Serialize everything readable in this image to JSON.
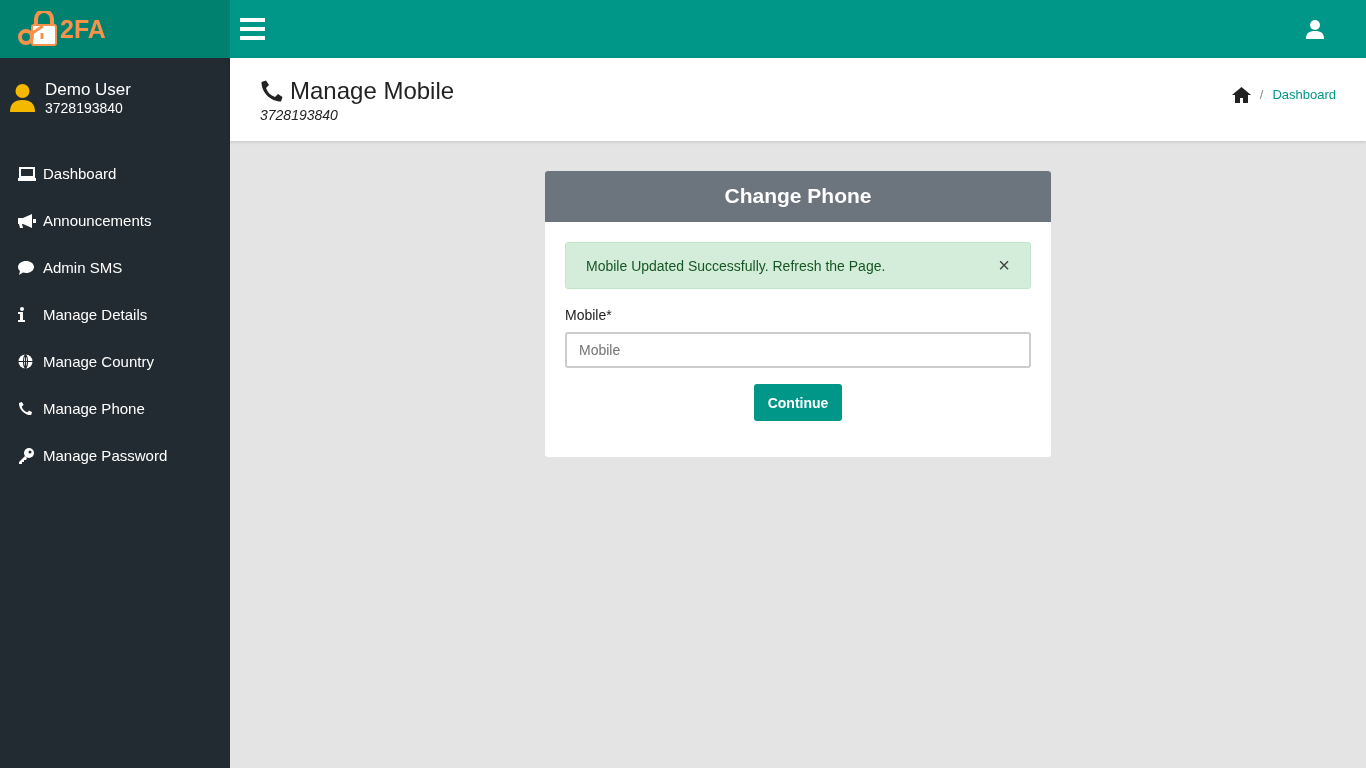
{
  "logo": {
    "text": "2FA"
  },
  "user": {
    "name": "Demo User",
    "phone": "3728193840"
  },
  "sidebar": {
    "items": [
      {
        "label": "Dashboard"
      },
      {
        "label": "Announcements"
      },
      {
        "label": "Admin SMS"
      },
      {
        "label": "Manage Details"
      },
      {
        "label": "Manage Country"
      },
      {
        "label": "Manage Phone"
      },
      {
        "label": "Manage Password"
      }
    ]
  },
  "page_header": {
    "title": "Manage Mobile",
    "subtitle": "3728193840",
    "breadcrumb": {
      "separator": "/",
      "link": "Dashboard"
    }
  },
  "card": {
    "title": "Change Phone",
    "alert": {
      "message": "Mobile Updated Successfully. Refresh the Page.",
      "close": "×"
    },
    "field": {
      "label": "Mobile*",
      "placeholder": "Mobile"
    },
    "button": "Continue"
  }
}
